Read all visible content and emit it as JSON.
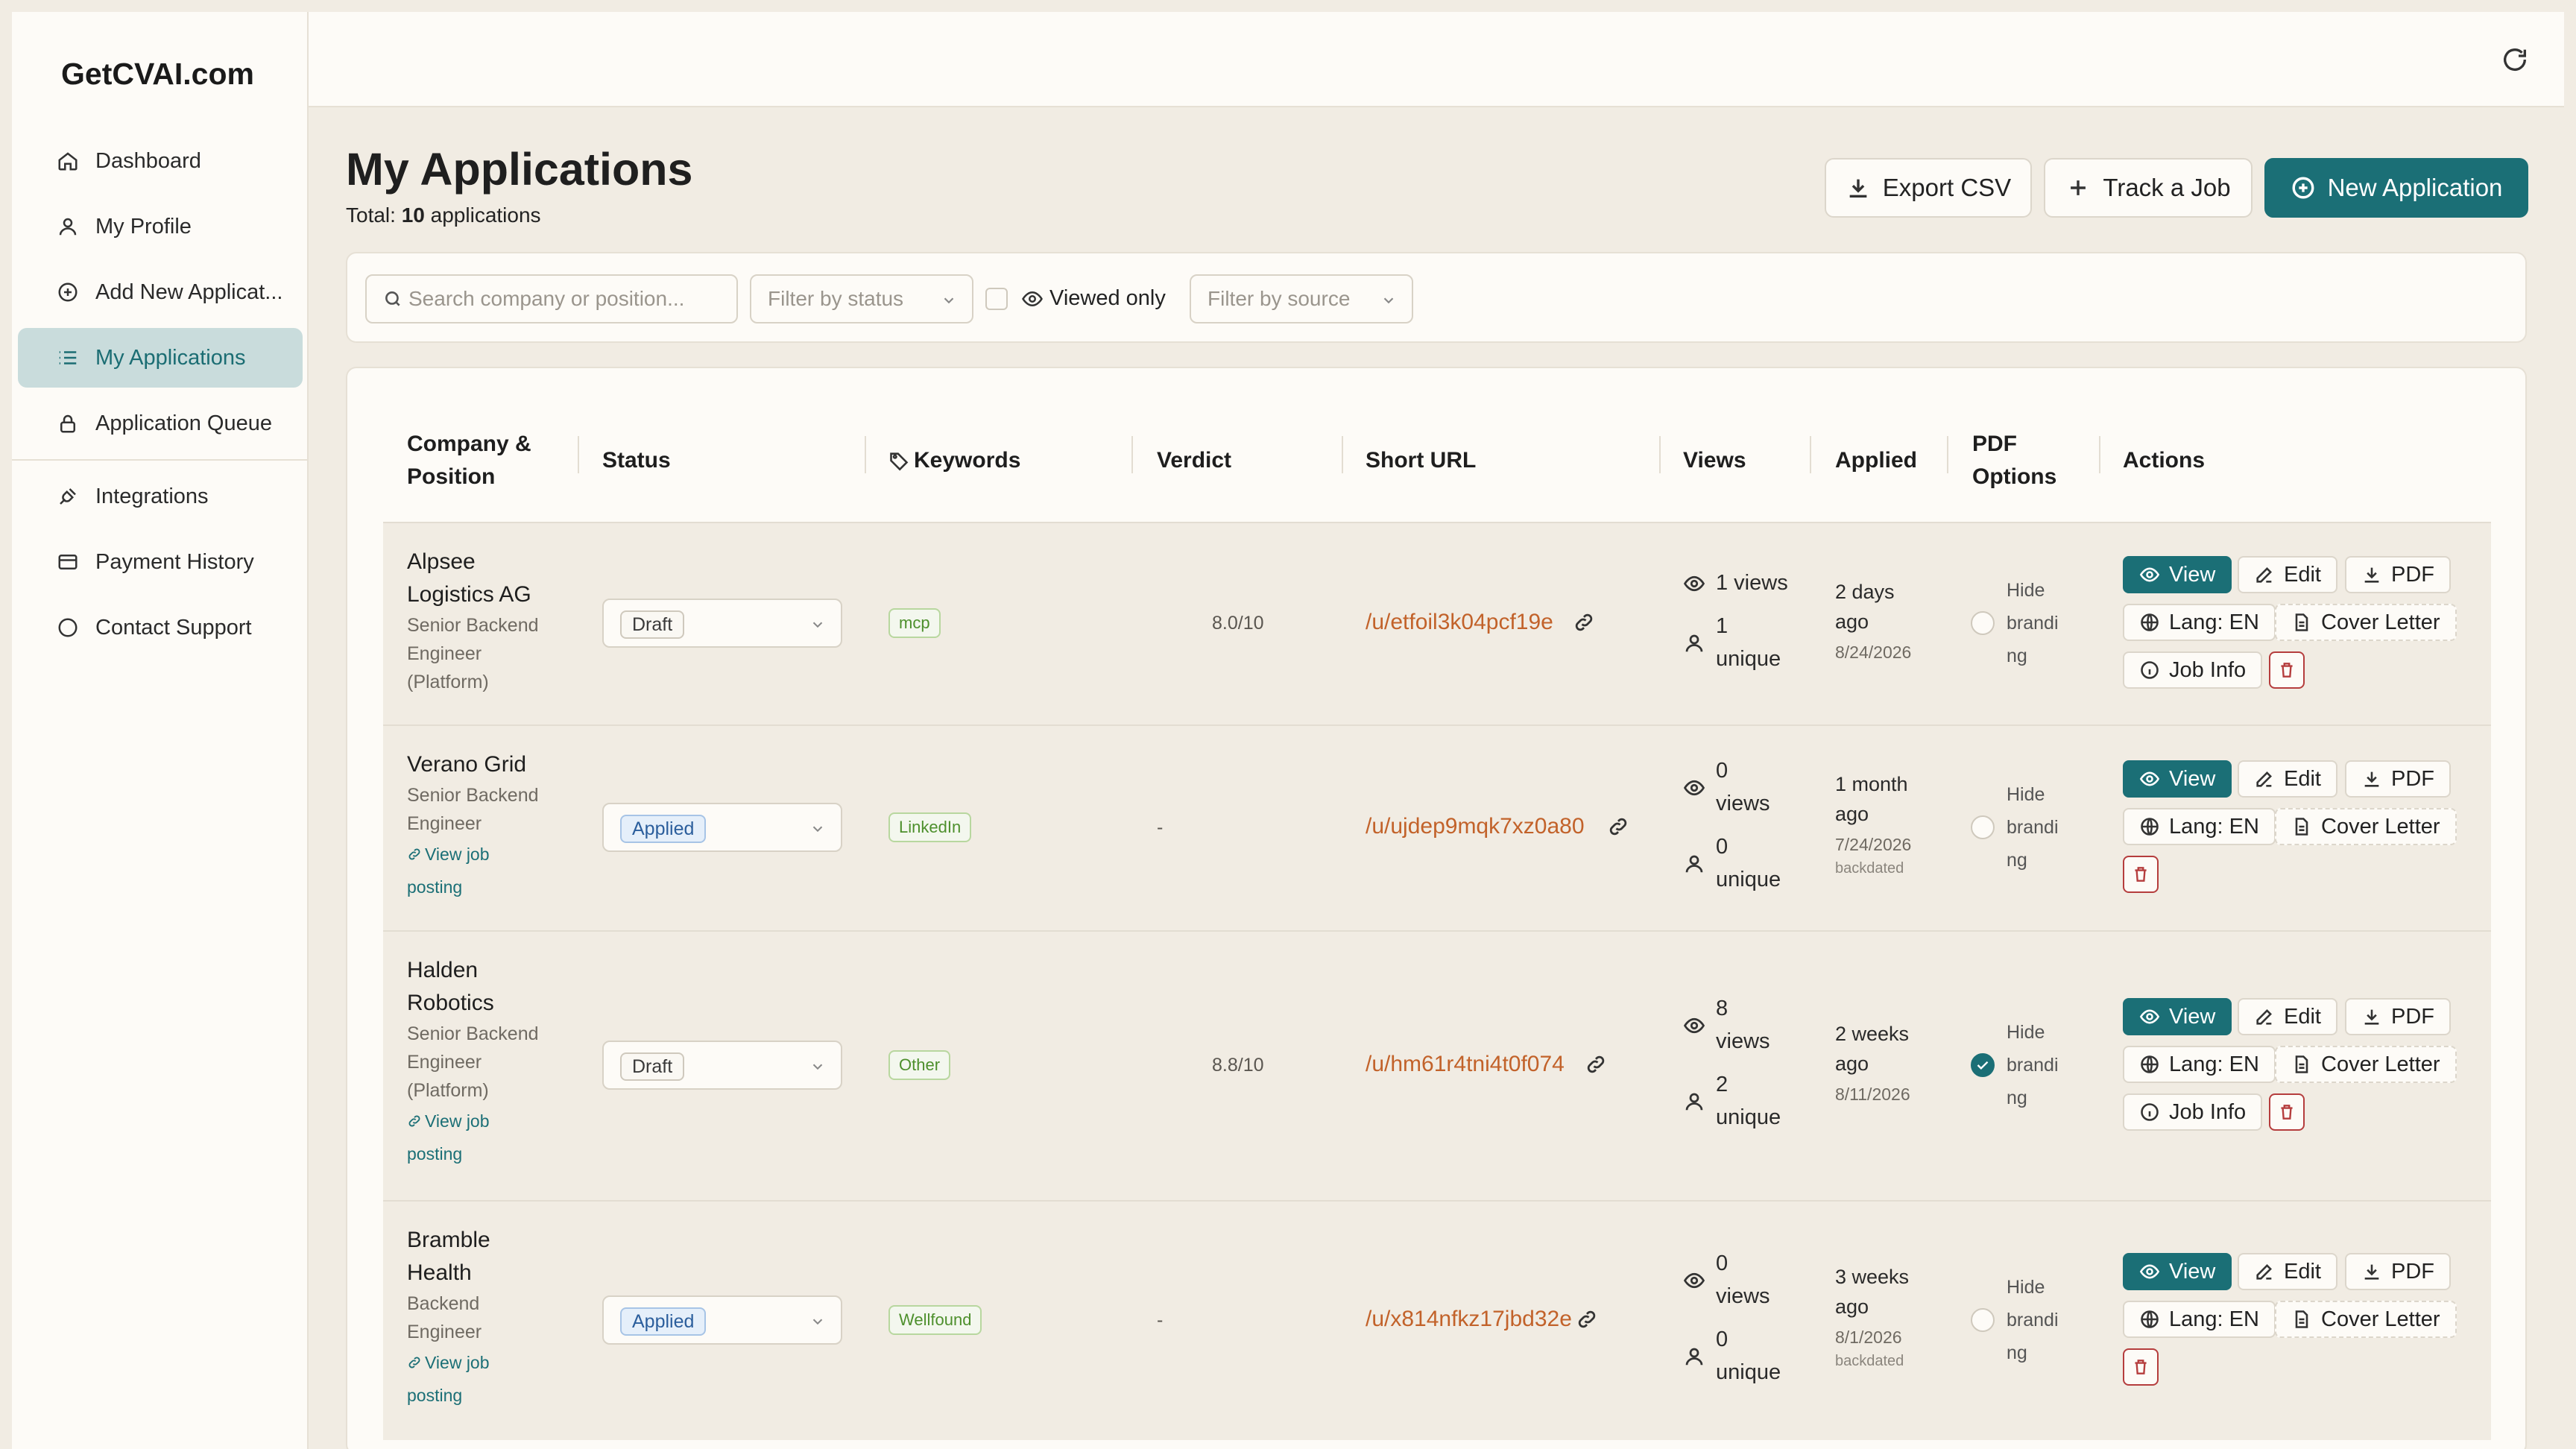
{
  "app": {
    "brand": "GetCVAI.com"
  },
  "sidebar": {
    "items": [
      {
        "label": "Dashboard",
        "icon": "home-icon"
      },
      {
        "label": "My Profile",
        "icon": "user-icon"
      },
      {
        "label": "Add New Applicat...",
        "icon": "plus-circle-icon"
      },
      {
        "label": "My Applications",
        "icon": "list-icon",
        "active": true
      },
      {
        "label": "Application Queue",
        "icon": "lock-icon"
      },
      {
        "label": "Integrations",
        "icon": "plug-icon"
      },
      {
        "label": "Payment History",
        "icon": "credit-card-icon"
      },
      {
        "label": "Contact Support",
        "icon": "chat-icon"
      }
    ]
  },
  "header": {
    "title": "My Applications",
    "total_prefix": "Total:",
    "total_count": "10",
    "total_suffix": "applications",
    "export_label": "Export CSV",
    "track_label": "Track a Job",
    "new_label": "New Application"
  },
  "filters": {
    "search_placeholder": "Search company or position...",
    "status_placeholder": "Filter by status",
    "viewed_only_label": "Viewed only",
    "source_placeholder": "Filter by source"
  },
  "table": {
    "columns": {
      "company_line1": "Company &",
      "company_line2": "Position",
      "status": "Status",
      "keywords": "Keywords",
      "verdict": "Verdict",
      "short_url": "Short URL",
      "views": "Views",
      "applied": "Applied",
      "pdf_line1": "PDF",
      "pdf_line2": "Options",
      "actions": "Actions"
    },
    "rows": [
      {
        "company": [
          "Alpsee",
          "Logistics AG"
        ],
        "position": [
          "Senior Backend",
          "Engineer",
          "(Platform)"
        ],
        "job_posting": null,
        "status": "Draft",
        "keyword": "mcp",
        "verdict": "8.0/10",
        "short_url": "/u/etfoil3k04pcf19e",
        "views": [
          "1 views"
        ],
        "unique": [
          "1",
          "unique"
        ],
        "applied": [
          "2 days",
          "ago"
        ],
        "applied_date": "8/24/2026",
        "backdated": "",
        "hide_branding": false,
        "job_info": true
      },
      {
        "company": [
          "Verano Grid"
        ],
        "position": [
          "Senior Backend",
          "Engineer"
        ],
        "job_posting": [
          "View job",
          "posting"
        ],
        "status": "Applied",
        "keyword": "LinkedIn",
        "verdict": "-",
        "short_url": "/u/ujdep9mqk7xz0a80",
        "views": [
          "0",
          "views"
        ],
        "unique": [
          "0",
          "unique"
        ],
        "applied": [
          "1 month",
          "ago"
        ],
        "applied_date": "7/24/2026",
        "backdated": "backdated",
        "hide_branding": false,
        "job_info": false
      },
      {
        "company": [
          "Halden",
          "Robotics"
        ],
        "position": [
          "Senior Backend",
          "Engineer",
          "(Platform)"
        ],
        "job_posting": [
          "View job",
          "posting"
        ],
        "status": "Draft",
        "keyword": "Other",
        "verdict": "8.8/10",
        "short_url": "/u/hm61r4tni4t0f074",
        "views": [
          "8",
          "views"
        ],
        "unique": [
          "2",
          "unique"
        ],
        "applied": [
          "2 weeks",
          "ago"
        ],
        "applied_date": "8/11/2026",
        "backdated": "",
        "hide_branding": true,
        "job_info": true
      },
      {
        "company": [
          "Bramble",
          "Health"
        ],
        "position": [
          "Backend",
          "Engineer"
        ],
        "job_posting": [
          "View job",
          "posting"
        ],
        "status": "Applied",
        "keyword": "Wellfound",
        "verdict": "-",
        "short_url": "/u/x814nfkz17jbd32e",
        "views": [
          "0",
          "views"
        ],
        "unique": [
          "0",
          "unique"
        ],
        "applied": [
          "3 weeks",
          "ago"
        ],
        "applied_date": "8/1/2026",
        "backdated": "backdated",
        "hide_branding": false,
        "job_info": false
      }
    ],
    "hide_label": [
      "Hide",
      "brandi",
      "ng"
    ],
    "actions": {
      "view": "View",
      "edit": "Edit",
      "pdf": "PDF",
      "lang": "Lang: EN",
      "cover": "Cover Letter",
      "job_info": "Job Info"
    }
  },
  "colors": {
    "accent": "#1b6f76",
    "link": "#c2622a",
    "danger": "#b53d3d",
    "background": "#f1ece3"
  }
}
